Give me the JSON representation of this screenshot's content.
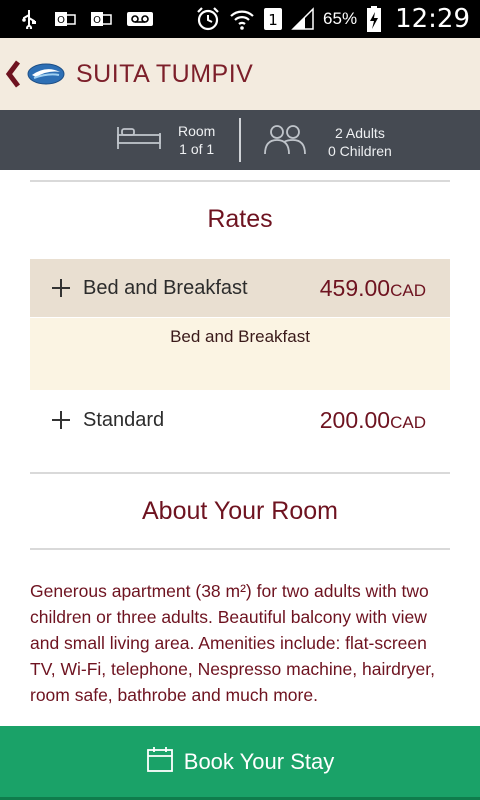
{
  "status_bar": {
    "battery_text": "65%",
    "time": "12:29",
    "sim_number": "1"
  },
  "header": {
    "title": "SUITA TUMPIV"
  },
  "summary": {
    "room_label": "Room",
    "room_count": "1 of 1",
    "adults": "2 Adults",
    "children": "0 Children"
  },
  "rates": {
    "title": "Rates",
    "items": [
      {
        "name": "Bed and Breakfast",
        "price": "459.00",
        "currency": "CAD",
        "detail": "Bed and Breakfast"
      },
      {
        "name": "Standard",
        "price": "200.00",
        "currency": "CAD"
      }
    ]
  },
  "about": {
    "title": "About Your Room",
    "text": "Generous apartment (38 m²) for two adults with two children or three adults. Beautiful balcony with view and small living area. Amenities include: flat-screen TV, Wi-Fi, telephone, Nespresso machine, hairdryer, room safe, bathrobe and much more."
  },
  "cta": {
    "label": "Book Your Stay"
  },
  "colors": {
    "brand": "#6e1320",
    "header_bg": "#f3ebdf",
    "summary_bg": "#454a52",
    "cta_bg": "#1aa268"
  }
}
